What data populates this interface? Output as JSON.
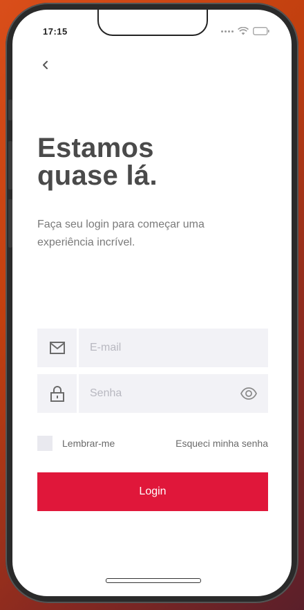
{
  "status_bar": {
    "time": "17:15"
  },
  "nav": {
    "back_icon": "chevron-left-icon"
  },
  "heading": {
    "title_line1": "Estamos",
    "title_line2": "quase lá.",
    "subtitle": "Faça seu login para começar uma experiência incrível."
  },
  "form": {
    "email": {
      "icon": "mail-icon",
      "placeholder": "E-mail",
      "value": ""
    },
    "password": {
      "icon": "lock-icon",
      "placeholder": "Senha",
      "value": "",
      "toggle_icon": "eye-icon"
    },
    "remember_label": "Lembrar-me",
    "remember_checked": false,
    "forgot_label": "Esqueci minha senha",
    "submit_label": "Login"
  },
  "colors": {
    "accent": "#e0173a",
    "input_bg": "#f2f2f6",
    "title": "#4a4a4a",
    "text_muted": "#7a7a7a"
  }
}
